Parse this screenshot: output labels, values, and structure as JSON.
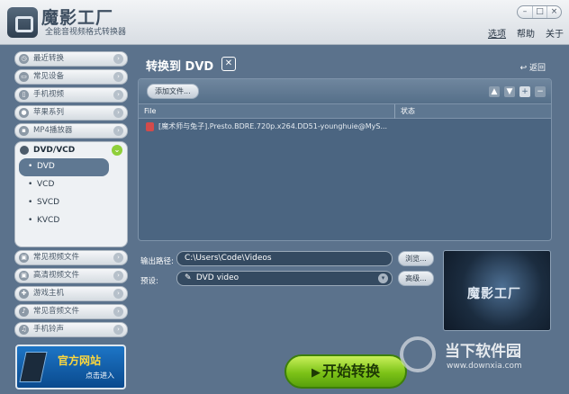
{
  "app": {
    "title": "魔影工厂",
    "subtitle": "全能音视频格式转换器"
  },
  "window_controls": [
    "–",
    "□",
    "×"
  ],
  "menu": [
    "选项",
    "帮助",
    "关于"
  ],
  "sidebar": {
    "items_top": [
      "最近转换",
      "常见设备",
      "手机视频",
      "苹果系列",
      "MP4播放器"
    ],
    "group": {
      "label": "DVD/VCD",
      "subs": [
        "DVD",
        "VCD",
        "SVCD",
        "KVCD"
      ],
      "active": "DVD"
    },
    "items_bottom": [
      "常见视频文件",
      "高清视频文件",
      "游戏主机",
      "常见音频文件",
      "手机铃声"
    ],
    "promo": {
      "title": "官方网站",
      "sub": "点击进入"
    }
  },
  "main": {
    "title": "转换到 DVD",
    "back_label": "返回",
    "add_file_label": "添加文件...",
    "columns": {
      "file": "File",
      "status": "状态"
    },
    "files": [
      {
        "name": "[魔术师与兔子].Presto.BDRE.720p.x264.DD51-younghuie@MyS...",
        "status": ""
      }
    ],
    "output_label": "输出路径:",
    "output_path": "C:\\Users\\Code\\Videos",
    "browse_label": "浏览...",
    "preset_label": "预设:",
    "preset_value": "DVD video",
    "advanced_label": "高级...",
    "preview_text": "魔影工厂",
    "start_label": "开始转换"
  },
  "watermark": {
    "title": "当下软件园",
    "url": "www.downxia.com"
  }
}
